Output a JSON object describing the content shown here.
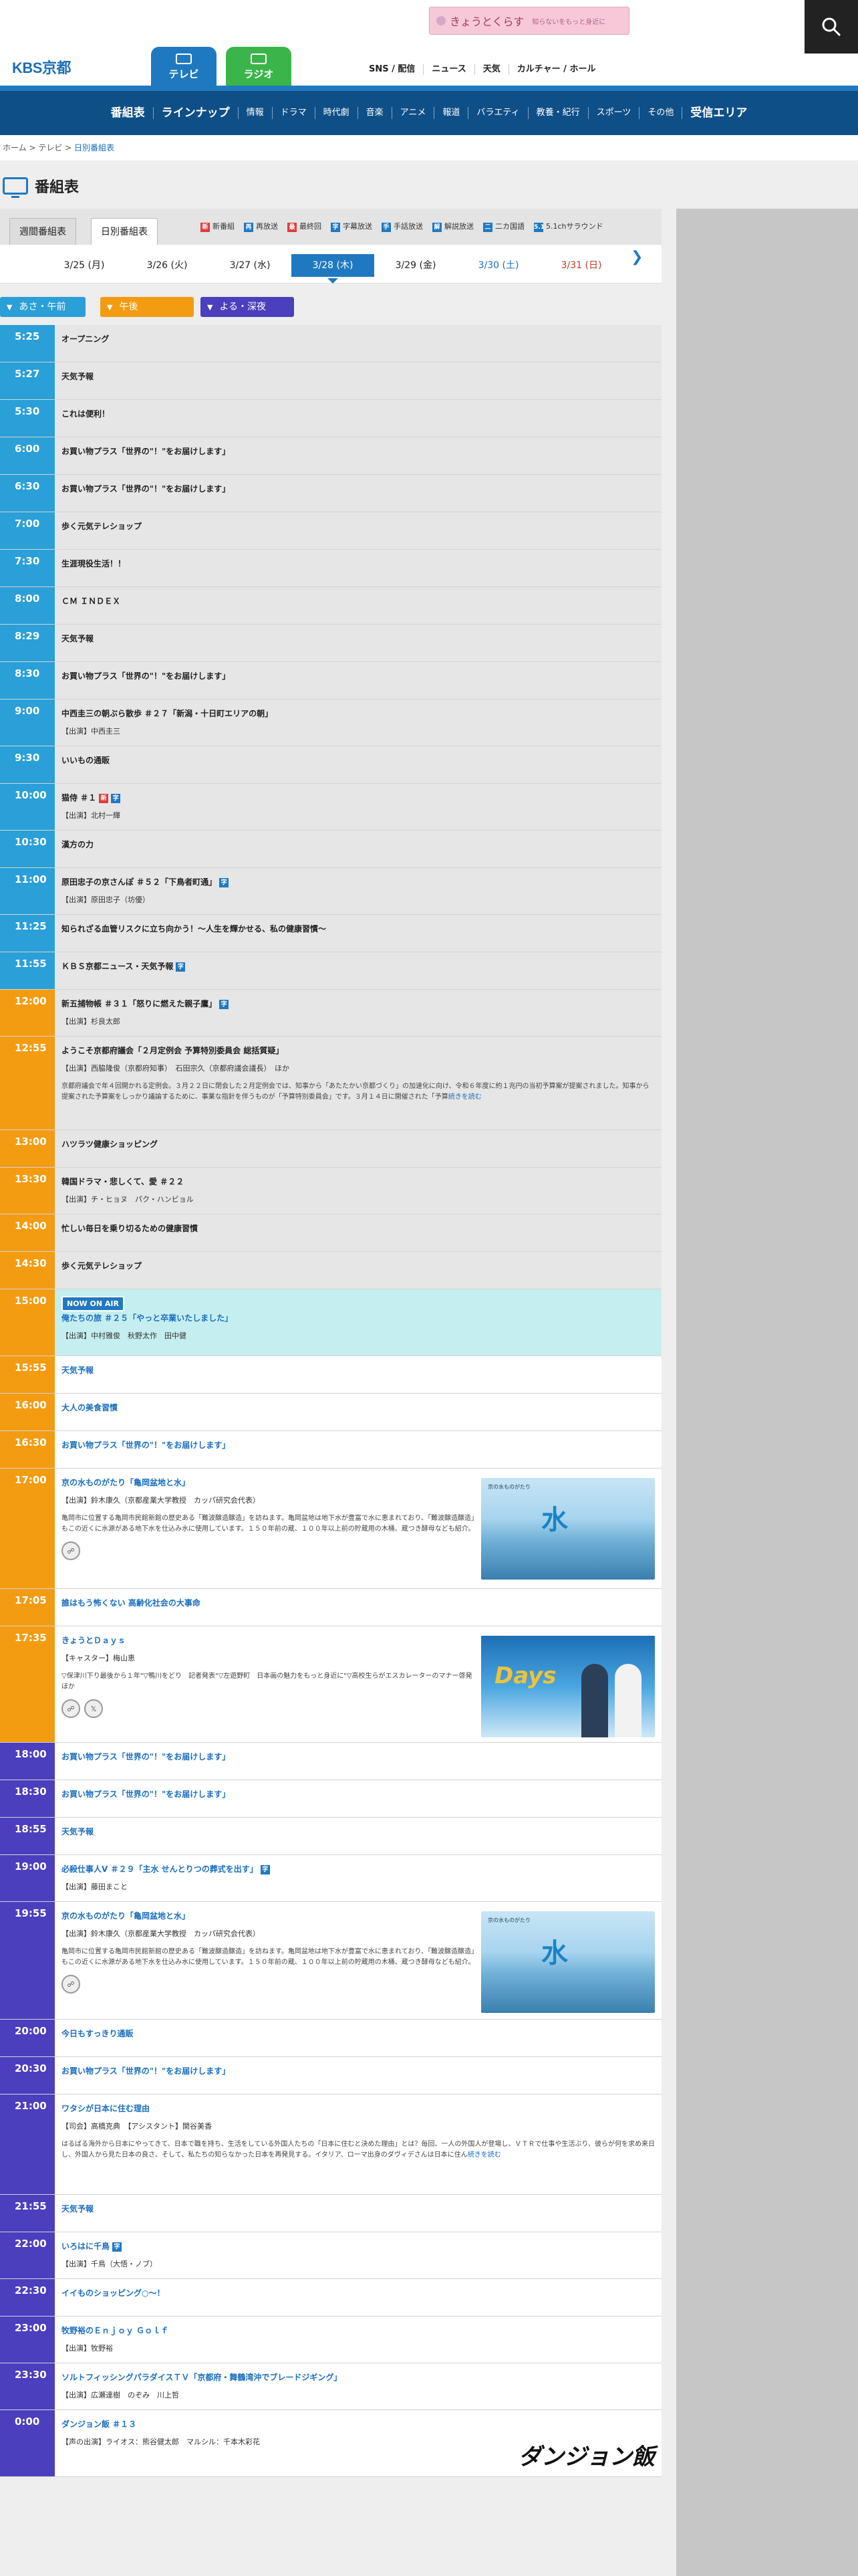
{
  "header": {
    "banner_title": "きょうとくらす",
    "banner_sub": "知らないをもっと身近に",
    "logo": "KBS京都",
    "tabs": [
      {
        "label": "テレビ"
      },
      {
        "label": "ラジオ"
      }
    ],
    "topnav": [
      "SNS / 配信",
      "ニュース",
      "天気",
      "カルチャー / ホール"
    ],
    "mainnav": [
      "番組表",
      "ラインナップ",
      "情報",
      "ドラマ",
      "時代劇",
      "音楽",
      "アニメ",
      "報道",
      "バラエティ",
      "教養・紀行",
      "スポーツ",
      "その他",
      "受信エリア"
    ]
  },
  "breadcrumb": [
    "ホーム",
    "テレビ",
    "日別番組表"
  ],
  "page_title": "番組表",
  "modes": [
    "週間番組表",
    "日別番組表"
  ],
  "legend": [
    {
      "mark": "新",
      "label": "新番組"
    },
    {
      "mark": "再",
      "label": "再放送"
    },
    {
      "mark": "最",
      "label": "最終回"
    },
    {
      "mark": "字",
      "label": "字幕放送"
    },
    {
      "mark": "手",
      "label": "手話放送"
    },
    {
      "mark": "解",
      "label": "解説放送"
    },
    {
      "mark": "二",
      "label": "二カ国語"
    },
    {
      "mark": "5.1",
      "label": "5.1chサラウンド"
    }
  ],
  "dates": [
    "3/25 (月)",
    "3/26 (火)",
    "3/27 (水)",
    "3/28 (木)",
    "3/29 (金)",
    "3/30 (土)",
    "3/31 (日)"
  ],
  "periods": [
    "あさ・午前",
    "午後",
    "よる・深夜"
  ],
  "now_on_air": "NOW ON AIR",
  "programs": [
    {
      "time": "5:25",
      "title": "オープニング"
    },
    {
      "time": "5:27",
      "title": "天気予報"
    },
    {
      "time": "5:30",
      "title": "これは便利！"
    },
    {
      "time": "6:00",
      "title": "お買い物プラス「世界の\"！\"をお届けします」"
    },
    {
      "time": "6:30",
      "title": "お買い物プラス「世界の\"！\"をお届けします」"
    },
    {
      "time": "7:00",
      "title": "歩く元気テレショップ"
    },
    {
      "time": "7:30",
      "title": "生涯現役生活！！"
    },
    {
      "time": "8:00",
      "title": "ＣＭ ＩＮＤＥＸ"
    },
    {
      "time": "8:29",
      "title": "天気予報"
    },
    {
      "time": "8:30",
      "title": "お買い物プラス「世界の\"！\"をお届けします」"
    },
    {
      "time": "9:00",
      "title": "中西圭三の朝ぶら散歩 ＃２７「新潟・十日町エリアの朝」",
      "sub": "【出演】中西圭三"
    },
    {
      "time": "9:30",
      "title": "いいもの通販"
    },
    {
      "time": "10:00",
      "title": "猫侍 ＃１",
      "sub": "【出演】北村一輝"
    },
    {
      "time": "10:30",
      "title": "漢方の力"
    },
    {
      "time": "11:00",
      "title": "原田忠子の京さんぽ ＃５２「下鳥者町通」",
      "sub": "【出演】原田忠子（坊優）"
    },
    {
      "time": "11:25",
      "title": "知られざる血管リスクに立ち向かう！～人生を輝かせる、私の健康習慣～"
    },
    {
      "time": "11:55",
      "title": "ＫＢＳ京都ニュース・天気予報"
    },
    {
      "time": "12:00",
      "title": "新五捕物帳 ＃３１「怒りに燃えた親子鷹」",
      "sub": "【出演】杉良太郎"
    },
    {
      "time": "12:55",
      "title": "ようこそ京都府議会「２月定例会 予算特別委員会 総括質疑」",
      "sub": "【出演】西脇隆俊（京都府知事）　石田宗久（京都府議会議長）　ほか",
      "desc": "京都府議会で年４回開かれる定例会。３月２２日に閉会した２月定例会では、知事から「あたたかい京都づくり」の加速化に向け、令和６年度に約１兆円の当初予算案が提案されました。知事から提案された予算案をしっかり議論するために、事業な指針を伴うものが「予算特別委員会」です。３月１４日に開催された「予算",
      "more": "続きを読む"
    },
    {
      "time": "13:00",
      "title": "ハツラツ健康ショッピング"
    },
    {
      "time": "13:30",
      "title": "韓国ドラマ・悲しくて、愛 ＃２２",
      "sub": "【出演】チ・ヒョヌ　パク・ハンビョル"
    },
    {
      "time": "14:00",
      "title": "忙しい毎日を乗り切るための健康習慣"
    },
    {
      "time": "14:30",
      "title": "歩く元気テレショップ"
    },
    {
      "time": "15:00",
      "title": "俺たちの旅 ＃２５「やっと卒業いたしました」",
      "sub": "【出演】中村雅俊　秋野太作　田中健"
    },
    {
      "time": "15:55",
      "title": "天気予報"
    },
    {
      "time": "16:00",
      "title": "大人の美食習慣"
    },
    {
      "time": "16:30",
      "title": "お買い物プラス「世界の\"！\"をお届けします」"
    },
    {
      "time": "17:00",
      "title": "京の水ものがたり「亀岡盆地と水」",
      "sub": "【出演】鈴木康久（京都産業大学教授　カッパ研究会代表）",
      "desc": "亀岡市に位置する亀岡市民館新館の歴史ある「難波醸造醸造」を訪ねます。亀岡盆地は地下水が豊富で水に恵まれており、「難波醸造醸造」もこの近くに水源がある地下水を仕込み水に使用しています。１５０年前の蔵、１００年以上前の貯蔵用の木桶、蔵つき酵母なども紹介。",
      "thumb_label": "京の水ものがたり",
      "thumb_text": "水"
    },
    {
      "time": "17:05",
      "title": "誰はもう怖くない 高齢化社会の大事命"
    },
    {
      "time": "17:35",
      "title": "きょうとＤａｙｓ",
      "sub": "【キャスター】梅山恵",
      "desc": "▽保津川下り最後から１年\"▽鴨川をどり　記者発表\"▽左遊野町　日本画の魅力をもっと身近に\"▽高校生らがエスカレーターのマナー啓発　ほか",
      "thumb_text": "Days"
    },
    {
      "time": "18:00",
      "title": "お買い物プラス「世界の\"！\"をお届けします」"
    },
    {
      "time": "18:30",
      "title": "お買い物プラス「世界の\"！\"をお届けします」"
    },
    {
      "time": "18:55",
      "title": "天気予報"
    },
    {
      "time": "19:00",
      "title": "必殺仕事人Ⅴ ＃２９「主水 せんとりつの葬式を出す」",
      "sub": "【出演】藤田まこと"
    },
    {
      "time": "19:55",
      "title": "京の水ものがたり「亀岡盆地と水」",
      "sub": "【出演】鈴木康久（京都産業大学教授　カッパ研究会代表）",
      "desc": "亀岡市に位置する亀岡市民館新館の歴史ある「難波醸造醸造」を訪ねます。亀岡盆地は地下水が豊富で水に恵まれており、「難波醸造醸造」もこの近くに水源がある地下水を仕込み水に使用しています。１５０年前の蔵、１００年以上前の貯蔵用の木桶、蔵つき酵母なども紹介。",
      "thumb_label": "京の水ものがたり",
      "thumb_text": "水"
    },
    {
      "time": "20:00",
      "title": "今日もすっきり通販"
    },
    {
      "time": "20:30",
      "title": "お買い物プラス「世界の\"！\"をお届けします」"
    },
    {
      "time": "21:00",
      "title": "ワタシが日本に住む理由",
      "sub": "【司会】高橋克典　【アシスタント】関谷美香",
      "desc": "はるばる海外から日本にやってきて、日本で職を持ち、生活をしている外国人たちの「日本に住むと決めた理由」とは？毎回、一人の外国人が登場し、ＶＴＲで仕事や生活ぶり、彼らが何を求め来日し、外国人から見た日本の良さ、そして、私たちの知らなかった日本を再発見する。イタリア、ローマ出身のダヴィデさんは日本に住ん",
      "more": "続きを読む"
    },
    {
      "time": "21:55",
      "title": "天気予報"
    },
    {
      "time": "22:00",
      "title": "いろはに千鳥",
      "sub": "【出演】千鳥（大悟・ノブ）"
    },
    {
      "time": "22:30",
      "title": "イイものショッピング○～！"
    },
    {
      "time": "23:00",
      "title": "牧野裕のＥｎｊｏｙ Ｇｏｌｆ",
      "sub": "【出演】牧野裕"
    },
    {
      "time": "23:30",
      "title": "ソルトフィッシングパラダイスＴＶ「京都府・舞鶴湾沖でブレードジギング」",
      "sub": "【出演】広瀬達樹　のぞみ　川上哲"
    },
    {
      "time": "0:00",
      "title": "ダンジョン飯 ＃１３",
      "sub": "【声の出演】ライオス：熊谷健太郎　マルシル：千本木彩花",
      "thumb_text": "ダンジョン飯"
    }
  ],
  "colors": {
    "morning": "#2a9fd8",
    "noon": "#f39c12",
    "night": "#4b3fbd",
    "accent": "#1f79c1"
  }
}
